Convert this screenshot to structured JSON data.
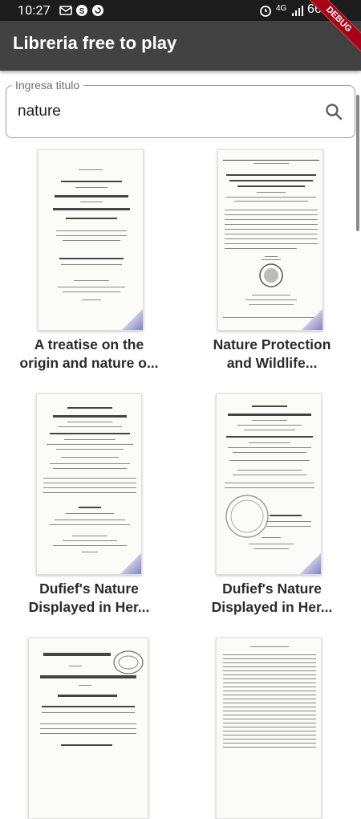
{
  "status_bar": {
    "time": "10:27",
    "battery": "66%",
    "network": "4G",
    "notification_icons": [
      "mail-icon",
      "s-icon",
      "refresh-icon"
    ],
    "right_icons": [
      "alarm-icon",
      "signal-icon",
      "battery-icon"
    ]
  },
  "app_bar": {
    "title": "Libreria free to play",
    "debug_banner": "DEBUG"
  },
  "search": {
    "label": "Ingresa titulo",
    "value": "nature",
    "icon": "search-icon"
  },
  "books": [
    {
      "title_line1": "A treatise on the",
      "title_line2": "origin and nature o..."
    },
    {
      "title_line1": "Nature Protection",
      "title_line2": "and Wildlife..."
    },
    {
      "title_line1": "Dufief's Nature",
      "title_line2": "Displayed in Her..."
    },
    {
      "title_line1": "Dufief's Nature",
      "title_line2": "Displayed in Her..."
    },
    {
      "title_line1": "",
      "title_line2": ""
    },
    {
      "title_line1": "",
      "title_line2": ""
    }
  ],
  "covers": [
    {
      "heading": "A TREATISE ON THE ORIGIN AND NATURE OF DIGNITIES"
    },
    {
      "heading": "NATURE PROTECTION AND WILDLIFE PRESERVATION IN THE WESTERN HEMISPHERE"
    },
    {
      "heading": "DUFIEF'S NATURE DISPLAYED"
    },
    {
      "heading": "DUFIEF'S NATURE DISPLAY"
    },
    {
      "heading": "CURSO COMPLETO DICCIONARIO UNIVERSAL DE AGRICULTURA"
    },
    {
      "heading": "TABLE OF CONTENTS"
    }
  ]
}
